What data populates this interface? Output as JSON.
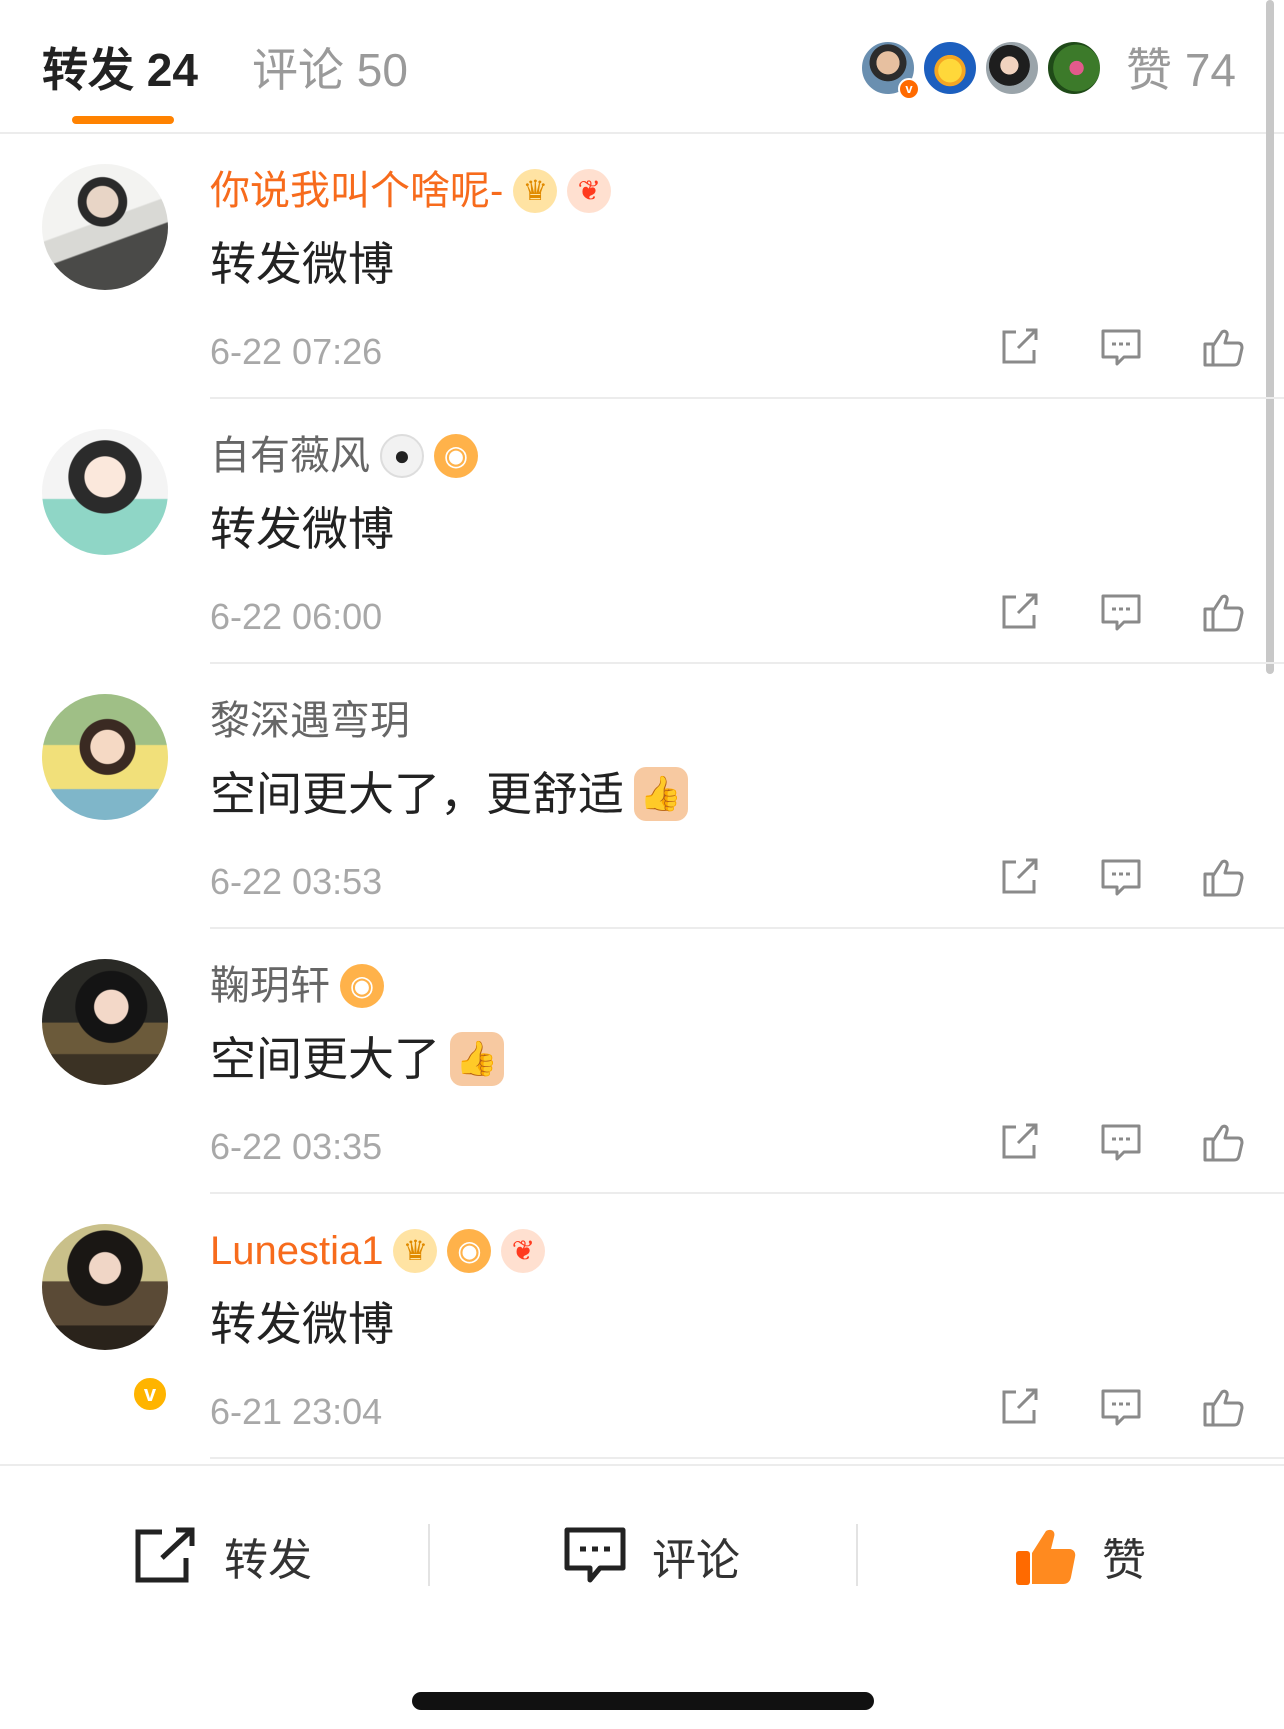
{
  "tabs": {
    "reposts_label": "转发 24",
    "comments_label": "评论 50",
    "likes_label": "赞 74",
    "active": "reposts",
    "accent_color": "#ff8200"
  },
  "liker_avatars": [
    {
      "icon": "avatar-photo-man",
      "verified_mark": "v"
    },
    {
      "icon": "avatar-pikachu"
    },
    {
      "icon": "avatar-photo-woman"
    },
    {
      "icon": "avatar-photo-garden"
    }
  ],
  "reposts": [
    {
      "username": "你说我叫个啥呢-",
      "username_color": "#f76b1c",
      "badges": [
        "crown-icon",
        "koi-fish-icon"
      ],
      "content": "转发微博",
      "content_emoji": null,
      "time": "6-22 07:26",
      "verified": false
    },
    {
      "username": "自有薇风",
      "username_color": "#666666",
      "badges": [
        "panda-icon",
        "puffer-fish-icon"
      ],
      "content": "转发微博",
      "content_emoji": null,
      "time": "6-22 06:00",
      "verified": false
    },
    {
      "username": "黎深遇弯玥",
      "username_color": "#666666",
      "badges": [],
      "content": "空间更大了，更舒适",
      "content_emoji": "thumbs-up-emoji",
      "time": "6-22 03:53",
      "verified": false
    },
    {
      "username": "鞠玥轩",
      "username_color": "#666666",
      "badges": [
        "puffer-fish-icon"
      ],
      "content": "空间更大了",
      "content_emoji": "thumbs-up-emoji",
      "time": "6-22 03:35",
      "verified": false
    },
    {
      "username": "Lunestia1",
      "username_color": "#f76b1c",
      "badges": [
        "crown-icon",
        "puffer-fish-icon",
        "koi-fish-icon"
      ],
      "content": "转发微博",
      "content_emoji": null,
      "time": "6-21 23:04",
      "verified": true
    }
  ],
  "bottom_bar": {
    "repost_label": "转发",
    "comment_label": "评论",
    "like_label": "赞",
    "like_color": "#ff6a00"
  }
}
